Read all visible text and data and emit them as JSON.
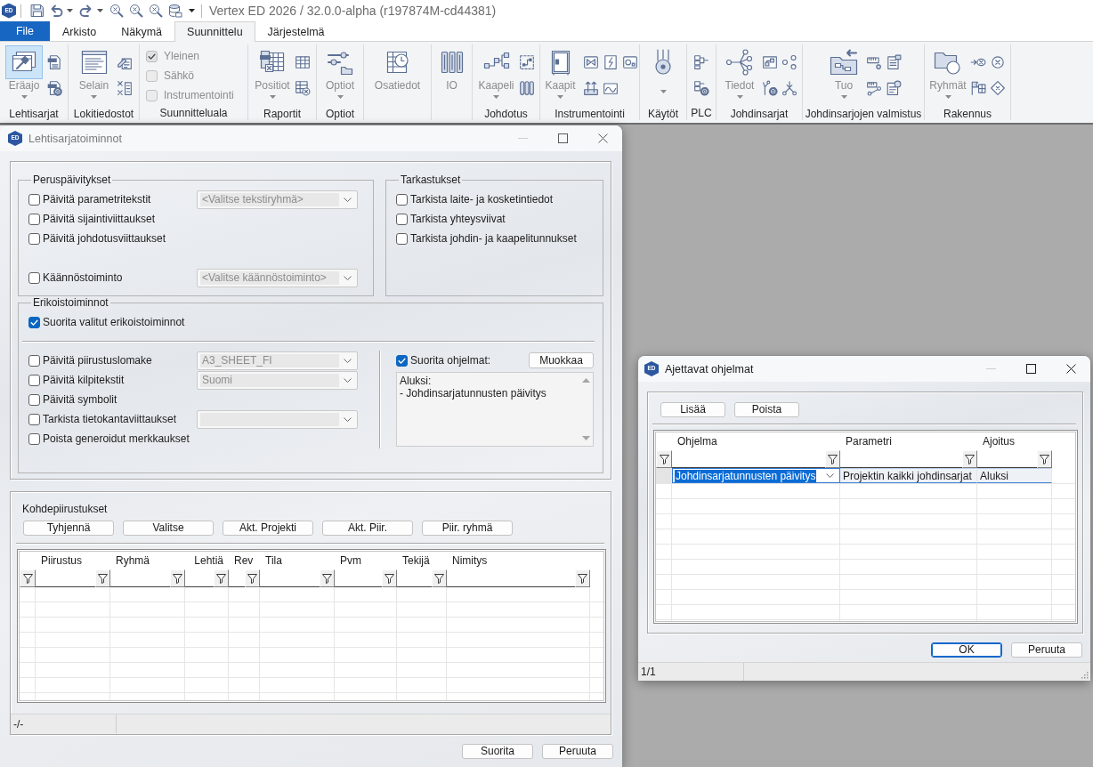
{
  "app": {
    "logo_text": "ED",
    "title": "Vertex ED 2026 / 32.0.0-alpha (r197874M-cd44381)"
  },
  "ribbon_tabs": [
    {
      "label": "File",
      "kind": "file",
      "selected": false
    },
    {
      "label": "Arkisto",
      "kind": "tab",
      "selected": false
    },
    {
      "label": "Näkymä",
      "kind": "tab",
      "selected": false
    },
    {
      "label": "Suunnittelu",
      "kind": "tab",
      "selected": true
    },
    {
      "label": "Järjestelmä",
      "kind": "tab",
      "selected": false
    }
  ],
  "ribbon": {
    "disabled": true,
    "groups": [
      {
        "label": "Lehtisarjat",
        "items": [
          {
            "kind": "large",
            "label": "Eräajo",
            "dropdown": true,
            "selected": true
          }
        ]
      },
      {
        "label": "Lokitiedostot",
        "items": [
          {
            "kind": "large",
            "label": "Selain",
            "dropdown": true,
            "selected": false
          }
        ]
      },
      {
        "label": "Suunnitteluala",
        "items": [
          {
            "kind": "check",
            "label": "Yleinen",
            "checked": true
          },
          {
            "kind": "check",
            "label": "Sähkö",
            "checked": false
          },
          {
            "kind": "check",
            "label": "Instrumentointi",
            "checked": false
          }
        ]
      },
      {
        "label": "Raportit",
        "items": [
          {
            "kind": "large",
            "label": "Positiot",
            "dropdown": true,
            "selected": false
          }
        ]
      },
      {
        "label": "Optiot",
        "items": [
          {
            "kind": "large",
            "label": "Optiot",
            "dropdown": true,
            "selected": false
          }
        ]
      },
      {
        "items": [
          {
            "kind": "large",
            "label": "Osatiedot",
            "dropdown": false,
            "selected": false
          }
        ]
      },
      {
        "items": [
          {
            "kind": "large",
            "label": "IO",
            "dropdown": false,
            "selected": false
          }
        ]
      },
      {
        "label": "Johdotus",
        "items": [
          {
            "kind": "large",
            "label": "Kaapeli",
            "dropdown": true,
            "selected": false
          }
        ]
      },
      {
        "label": "Instrumentointi",
        "items": [
          {
            "kind": "large",
            "label": "Kaapit",
            "dropdown": true,
            "selected": false
          }
        ]
      },
      {
        "label": "Käytöt",
        "items": [
          {
            "kind": "large",
            "dropdown": true,
            "selected": false
          }
        ]
      },
      {
        "label": "PLC"
      },
      {
        "label": "Johdinsarjat",
        "items": [
          {
            "kind": "large",
            "label": "Tiedot",
            "dropdown": true,
            "selected": false
          }
        ]
      },
      {
        "label": "Johdinsarjojen valmistus",
        "items": [
          {
            "kind": "large",
            "label": "Tuo",
            "dropdown": true,
            "selected": false
          }
        ]
      },
      {
        "label": "Rakennus",
        "items": [
          {
            "kind": "large",
            "label": "Ryhmät",
            "dropdown": true,
            "selected": false
          }
        ]
      }
    ]
  },
  "sheet_set_operations_dialog": {
    "logo_text": "ED",
    "title": "Lehtisarjatoiminnot",
    "active": false,
    "basic_updates": {
      "title": "Peruspäivitykset",
      "options": [
        {
          "label": "Päivitä parametritekstit",
          "checked": false,
          "dropdown": {
            "value": "<Valitse tekstiryhmä>",
            "disabled": true
          }
        },
        {
          "label": "Päivitä sijaintiviittaukset",
          "checked": false
        },
        {
          "label": "Päivitä johdotusviittaukset",
          "checked": false
        }
      ],
      "translation": {
        "label": "Käännöstoiminto",
        "checked": false,
        "dropdown": {
          "value": "<Valitse käännöstoiminto>",
          "disabled": true
        }
      }
    },
    "checks": {
      "title": "Tarkastukset",
      "options": [
        {
          "label": "Tarkista laite- ja kosketintiedot",
          "checked": false
        },
        {
          "label": "Tarkista yhteysviivat",
          "checked": false
        },
        {
          "label": "Tarkista johdin- ja kaapelitunnukset",
          "checked": false
        }
      ]
    },
    "special_functions": {
      "title": "Erikoistoiminnot",
      "run_selected": {
        "label": "Suorita valitut erikoistoiminnot",
        "checked": true
      },
      "options": [
        {
          "label": "Päivitä piirustuslomake",
          "checked": false,
          "dropdown": {
            "value": "A3_SHEET_FI",
            "disabled": true
          }
        },
        {
          "label": "Päivitä kilpitekstit",
          "checked": false,
          "dropdown": {
            "value": "Suomi",
            "disabled": true
          }
        },
        {
          "label": "Päivitä symbolit",
          "checked": false
        },
        {
          "label": "Tarkista tietokantaviittaukset",
          "checked": false,
          "dropdown": {
            "disabled": true
          }
        },
        {
          "label": "Poista generoidut merkkaukset",
          "checked": false
        }
      ],
      "run_programs": {
        "label": "Suorita ohjelmat:",
        "checked": true,
        "edit_button": "Muokkaa",
        "program_list": [
          "Aluksi:",
          "- Johdinsarjatunnusten päivitys"
        ]
      }
    },
    "target_drawings": {
      "title": "Kohdepiirustukset",
      "buttons": [
        "Tyhjennä",
        "Valitse",
        "Akt. Projekti",
        "Akt. Piir.",
        "Piir. ryhmä"
      ],
      "table": {
        "columns": [
          {
            "label": "Piirustus",
            "kind": "text"
          },
          {
            "label": "Ryhmä",
            "kind": "text"
          },
          {
            "label": "Lehtiä",
            "kind": "number"
          },
          {
            "label": "Rev",
            "kind": "text"
          },
          {
            "label": "Tila",
            "kind": "text"
          },
          {
            "label": "Pvm",
            "kind": "text"
          },
          {
            "label": "Tekijä",
            "kind": "text"
          },
          {
            "label": "Nimitys",
            "kind": "text"
          }
        ]
      }
    },
    "status_bar": {
      "text": "-/-"
    },
    "buttons": [
      "Suorita",
      "Peruuta"
    ]
  },
  "programs_dialog": {
    "logo_text": "ED",
    "title": "Ajettavat ohjelmat",
    "active": true,
    "buttons": [
      "Lisää",
      "Poista"
    ],
    "table": {
      "columns": [
        "Ohjelma",
        "Parametri",
        "Ajoitus"
      ],
      "rows": [
        {
          "selected": true,
          "cells": [
            {
              "kind": "combo",
              "value": "Johdinsarjatunnusten päivitys"
            },
            {
              "kind": "text",
              "value": "Projektin kaikki johdinsarjat"
            },
            {
              "kind": "text",
              "value": "Aluksi"
            }
          ]
        }
      ]
    },
    "footer_buttons": [
      {
        "label": "OK",
        "default": true
      },
      {
        "label": "Peruuta",
        "default": false
      }
    ],
    "status_bar": {
      "text": "1/1"
    }
  }
}
